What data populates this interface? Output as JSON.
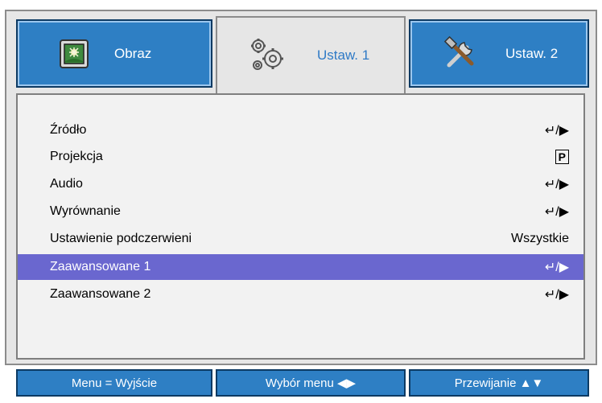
{
  "tabs": [
    {
      "label": "Obraz",
      "icon": "picture-icon",
      "state": "inactive"
    },
    {
      "label": "Ustaw. 1",
      "icon": "gears-icon",
      "state": "active"
    },
    {
      "label": "Ustaw. 2",
      "icon": "tools-icon",
      "state": "inactive"
    }
  ],
  "menu": {
    "items": [
      {
        "label": "Źródło",
        "value": "↵/▶"
      },
      {
        "label": "Projekcja",
        "value": "P"
      },
      {
        "label": "Audio",
        "value": "↵/▶"
      },
      {
        "label": "Wyrównanie",
        "value": "↵/▶"
      },
      {
        "label": "Ustawienie podczerwieni",
        "value": "Wszystkie"
      },
      {
        "label": "Zaawansowane 1",
        "value": "↵/▶"
      },
      {
        "label": "Zaawansowane 2",
        "value": "↵/▶"
      }
    ],
    "selected_index": 5
  },
  "footer": {
    "menu_exit": "Menu = Wyjście",
    "select_menu": "Wybór menu ◀▶",
    "scroll": "Przewijanie ▲▼"
  },
  "colors": {
    "tab_blue": "#2e7fc4",
    "selected_row": "#6a67cf",
    "active_tab_text": "#2f7ac6"
  }
}
